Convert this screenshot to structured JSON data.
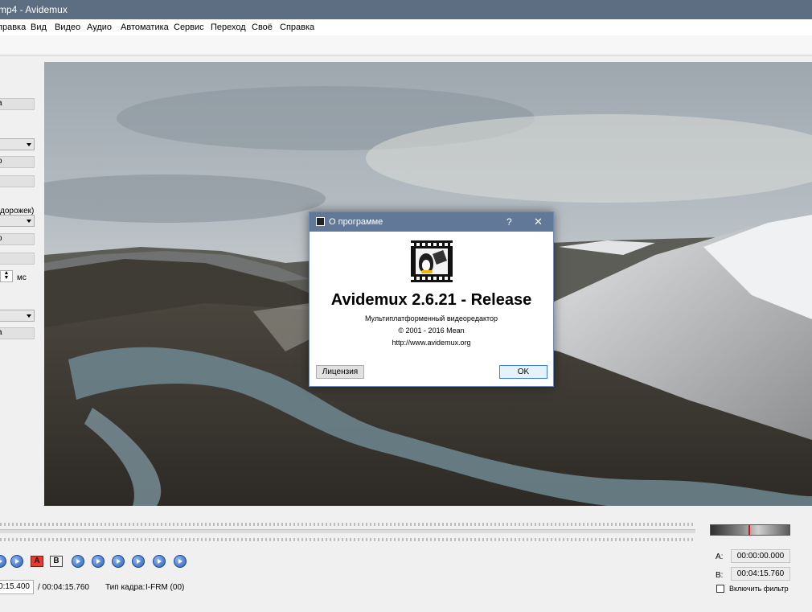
{
  "window": {
    "title": "mp4 - Avidemux"
  },
  "menu": [
    "правка",
    "Вид",
    "Видео",
    "Аудио",
    "Автоматика",
    "Сервис",
    "Переход",
    "Своё",
    "Справка"
  ],
  "left_panel": {
    "button_1": "а",
    "combo_1": "",
    "button_2": "о",
    "button_3": "",
    "tracks_label": "дорожек)",
    "combo_2": "",
    "button_4": "о",
    "button_5": "",
    "spin_unit": "мс",
    "combo_3": "",
    "button_6": "а"
  },
  "dialog": {
    "title": "О программе",
    "help": "?",
    "close": "✕",
    "heading": "Avidemux 2.6.21 - Release",
    "subtitle": "Мультиплатформенный видеоредактор",
    "copyright": "© 2001 - 2016  Mean",
    "url": "http://www.avidemux.org",
    "license_button": "Лицензия",
    "ok_button": "OK"
  },
  "bottom": {
    "current_time": "0:15.400",
    "total_time": "/ 00:04:15.760",
    "frame_type_label": "Тип кадра:",
    "frame_type_value": "I-FRM (00)",
    "marker_a_label": "A:",
    "marker_a_value": "00:00:00.000",
    "marker_b_label": "B:",
    "marker_b_value": "00:04:15.760",
    "filter_label": "Включить фильтр",
    "ab_a": "A",
    "ab_b": "B"
  },
  "colors": {
    "titlebar": "#5d6d82",
    "dialog_title": "#627898",
    "ok_border": "#3c7fd4"
  }
}
